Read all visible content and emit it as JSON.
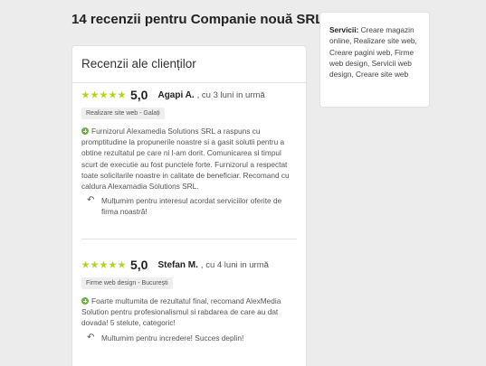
{
  "page_title": "14 recenzii pentru Companie nouă SRL",
  "reviews_card": {
    "title": "Recenzii ale clienților",
    "reviews": [
      {
        "rating": 5,
        "score": "5,0",
        "author": "Agapi A.",
        "meta": ", cu 3 luni in urmă",
        "tag": "Realizare site web - Galați",
        "text": "Furnizorul Alexamedia Solutions SRL a raspuns cu promptitudine la propunerile noastre si a gasit solutii pentru a obtine rezultatul pe care ni l-am dorit. Comunicarea si timpul scurt de executie au fost punctele forte. Furnizorul a respectat toate solicitarile noastre in calitate de beneficiar. Recomand cu caldura Alexamadia Solutions SRL.",
        "reply": "Mulțumim pentru interesul acordat serviciilor oferite de firma noastră!"
      },
      {
        "rating": 5,
        "score": "5,0",
        "author": "Stefan M.",
        "meta": ", cu 4 luni in urmă",
        "tag": "Firme web design - București",
        "text": "Foarte multumita de rezultatul final, recomand AlexMedia Solution pentru profesionalismul si rabdarea de care au dat dovada! 5 stelute, categoric!",
        "reply": "Multumim pentru incredere! Succes deplin!"
      }
    ]
  },
  "services": {
    "label": "Servicii:",
    "text": "Creare magazin online, Realizare site web, Creare pagini web, Firme web design, Servicii web design, Creare site web"
  },
  "colors": {
    "star": "#b6cf2d",
    "positive_icon": "#69b545",
    "background": "#ececec"
  },
  "icons": {
    "positive": "plus-circle-icon",
    "reply": "reply-arrow-icon",
    "star": "star-icon"
  }
}
